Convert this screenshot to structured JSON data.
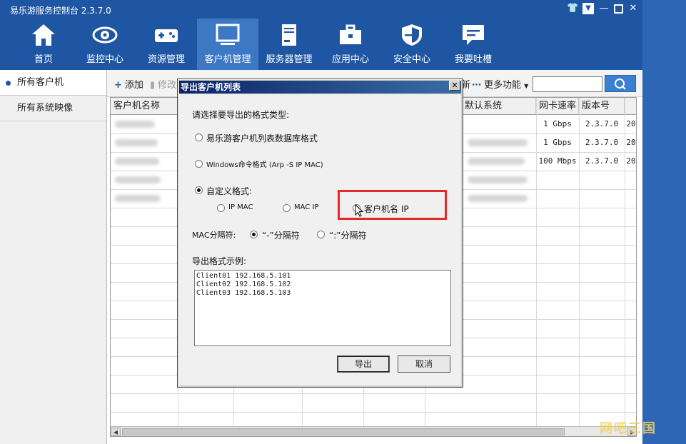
{
  "app": {
    "title": "易乐游服务控制台 2.3.7.0"
  },
  "nav": {
    "items": [
      {
        "label": "首页",
        "icon": "home-icon"
      },
      {
        "label": "监控中心",
        "icon": "eye-icon"
      },
      {
        "label": "资源管理",
        "icon": "gamepad-icon"
      },
      {
        "label": "客户机管理",
        "icon": "monitor-icon",
        "active": true
      },
      {
        "label": "服务器管理",
        "icon": "server-icon"
      },
      {
        "label": "应用中心",
        "icon": "toolbox-icon"
      },
      {
        "label": "安全中心",
        "icon": "shield-icon"
      },
      {
        "label": "我要吐槽",
        "icon": "chat-icon"
      }
    ]
  },
  "sidebar": {
    "items": [
      {
        "label": "所有客户机",
        "active": true
      },
      {
        "label": "所有系统映像"
      }
    ]
  },
  "toolbar": {
    "add": "添加",
    "edit": "修改",
    "refresh_tail": "新",
    "more": "更多功能"
  },
  "grid": {
    "headers": [
      "客户机名称",
      "默认系统",
      "网卡速率",
      "版本号"
    ],
    "rows": [
      {
        "speed": "1 Gbps",
        "version": "2.3.7.0",
        "tail": "20"
      },
      {
        "speed": "1 Gbps",
        "version": "2.3.7.0",
        "tail": "20"
      },
      {
        "speed": "100 Mbps",
        "version": "2.3.7.0",
        "tail": "20"
      }
    ]
  },
  "dialog": {
    "title": "导出客户机列表",
    "prompt": "请选择要导出的格式类型:",
    "option_db": "易乐游客户机列表数据库格式",
    "option_cmd": "Windows命令格式 (Arp -S IP MAC)",
    "option_custom": "自定义格式:",
    "sub_ip_mac": "IP MAC",
    "sub_mac_ip": "MAC IP",
    "sub_name_ip": "客户机名 IP",
    "sep_label": "MAC分隔符:",
    "sep_dash": "“-”分隔符",
    "sep_colon": "“:”分隔符",
    "example_label": "导出格式示例:",
    "example_lines": [
      "Client01 192.168.5.101",
      "Client02 192.168.5.102",
      "Client03 192.168.5.103"
    ],
    "export_btn": "导出",
    "cancel_btn": "取消"
  },
  "watermark": "网吧三国",
  "colors": {
    "brand": "#1f56a4",
    "highlight": "#e22a2a"
  }
}
